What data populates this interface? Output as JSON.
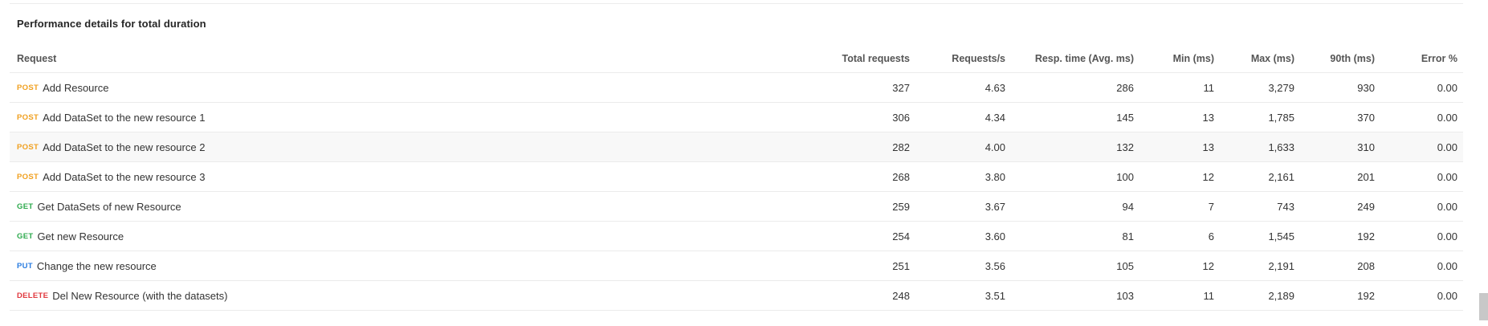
{
  "section": {
    "title": "Performance details for total duration"
  },
  "table": {
    "headers": {
      "request": "Request",
      "total_requests": "Total requests",
      "requests_per_s": "Requests/s",
      "resp_time": "Resp. time (Avg. ms)",
      "min": "Min (ms)",
      "max": "Max (ms)",
      "p90": "90th (ms)",
      "error": "Error %"
    },
    "rows": [
      {
        "method": "POST",
        "name": "Add Resource",
        "total": "327",
        "rps": "4.63",
        "resp": "286",
        "min": "11",
        "max": "3,279",
        "p90": "930",
        "err": "0.00"
      },
      {
        "method": "POST",
        "name": "Add DataSet to the new resource 1",
        "total": "306",
        "rps": "4.34",
        "resp": "145",
        "min": "13",
        "max": "1,785",
        "p90": "370",
        "err": "0.00"
      },
      {
        "method": "POST",
        "name": "Add DataSet to the new resource 2",
        "total": "282",
        "rps": "4.00",
        "resp": "132",
        "min": "13",
        "max": "1,633",
        "p90": "310",
        "err": "0.00"
      },
      {
        "method": "POST",
        "name": "Add DataSet to the new resource 3",
        "total": "268",
        "rps": "3.80",
        "resp": "100",
        "min": "12",
        "max": "2,161",
        "p90": "201",
        "err": "0.00"
      },
      {
        "method": "GET",
        "name": "Get DataSets of new Resource",
        "total": "259",
        "rps": "3.67",
        "resp": "94",
        "min": "7",
        "max": "743",
        "p90": "249",
        "err": "0.00"
      },
      {
        "method": "GET",
        "name": "Get new Resource",
        "total": "254",
        "rps": "3.60",
        "resp": "81",
        "min": "6",
        "max": "1,545",
        "p90": "192",
        "err": "0.00"
      },
      {
        "method": "PUT",
        "name": "Change the new resource",
        "total": "251",
        "rps": "3.56",
        "resp": "105",
        "min": "12",
        "max": "2,191",
        "p90": "208",
        "err": "0.00"
      },
      {
        "method": "DELETE",
        "name": "Del New Resource (with the datasets)",
        "total": "248",
        "rps": "3.51",
        "resp": "103",
        "min": "11",
        "max": "2,189",
        "p90": "192",
        "err": "0.00"
      }
    ],
    "highlighted_row": 2
  },
  "colors": {
    "POST": "#f0a020",
    "GET": "#2eaa4e",
    "PUT": "#2b7de0",
    "DELETE": "#e0383e"
  }
}
